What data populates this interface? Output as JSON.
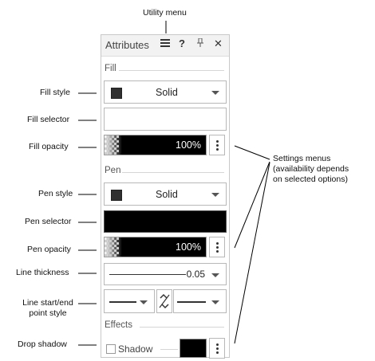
{
  "callouts": {
    "utility_menu": "Utility menu",
    "fill_style": "Fill style",
    "fill_selector": "Fill selector",
    "fill_opacity": "Fill opacity",
    "pen_style": "Pen style",
    "pen_selector": "Pen selector",
    "pen_opacity": "Pen opacity",
    "line_thickness": "Line thickness",
    "line_start_end_1": "Line start/end",
    "line_start_end_2": "point style",
    "drop_shadow": "Drop shadow",
    "settings_menus_1": "Settings menus",
    "settings_menus_2": "(availability depends",
    "settings_menus_3": "on selected options)"
  },
  "panel": {
    "title": "Attributes",
    "menu_icon": "hamburger-icon",
    "help_label": "?",
    "pin_icon": "pin-icon",
    "close_label": "✕"
  },
  "fill": {
    "section_label": "Fill",
    "style_value": "Solid",
    "swatch_color": "#303030",
    "opacity_value": "100%"
  },
  "pen": {
    "section_label": "Pen",
    "style_value": "Solid",
    "selector_color": "#000000",
    "opacity_value": "100%",
    "thickness_value": "0.05"
  },
  "effects": {
    "section_label": "Effects",
    "shadow_label": "Shadow",
    "shadow_checked": false,
    "shadow_color": "#000000"
  }
}
